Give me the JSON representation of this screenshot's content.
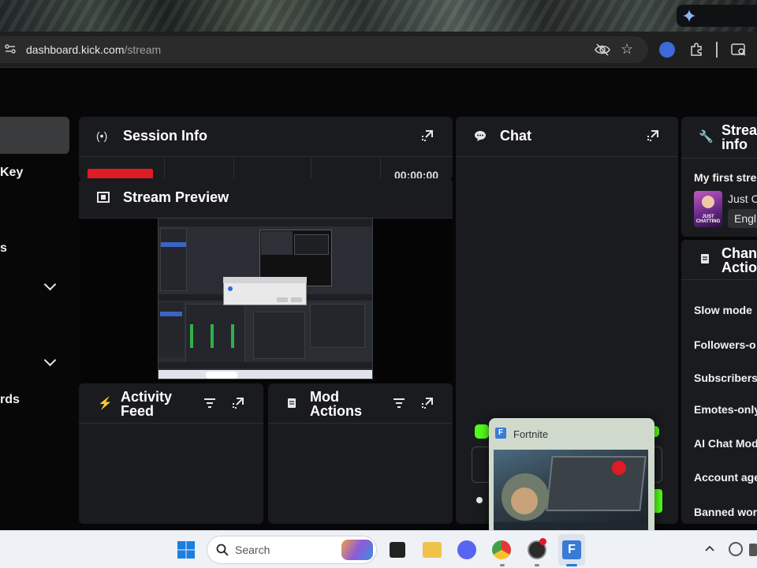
{
  "browser": {
    "url_host": "dashboard.kick.com",
    "url_path": "/stream"
  },
  "sidebar": {
    "items": [
      {
        "label": ""
      },
      {
        "label": "Key"
      },
      {
        "label": "s"
      },
      {
        "label": "rds"
      }
    ]
  },
  "session_info": {
    "title": "Session Info",
    "timer": "00:00:00"
  },
  "stream_preview": {
    "title": "Stream Preview"
  },
  "chat": {
    "title": "Chat"
  },
  "activity_feed": {
    "title_line1": "Activity",
    "title_line2": "Feed"
  },
  "mod_actions": {
    "title_line1": "Mod",
    "title_line2": "Actions"
  },
  "stream_info": {
    "title_line1": "Strea",
    "title_line2": "info",
    "stream_title": "My first stre",
    "category": "Just C",
    "language": "Engl",
    "thumb_text": "JUST CHATTING"
  },
  "channel_actions": {
    "title_line1": "Chan",
    "title_line2": "Actio",
    "items": [
      {
        "label": "Slow mode"
      },
      {
        "label": "Followers-o"
      },
      {
        "label": "Subscribers"
      },
      {
        "label": "Emotes-only"
      },
      {
        "label": "AI Chat Mod"
      },
      {
        "label": "Account age"
      },
      {
        "label": "Banned wor"
      }
    ]
  },
  "popup": {
    "title": "Fortnite"
  },
  "taskbar": {
    "search_placeholder": "Search"
  },
  "colors": {
    "accent_green": "#53fc18",
    "live_red": "#e01b24",
    "panel_bg": "#1a1b1e"
  }
}
